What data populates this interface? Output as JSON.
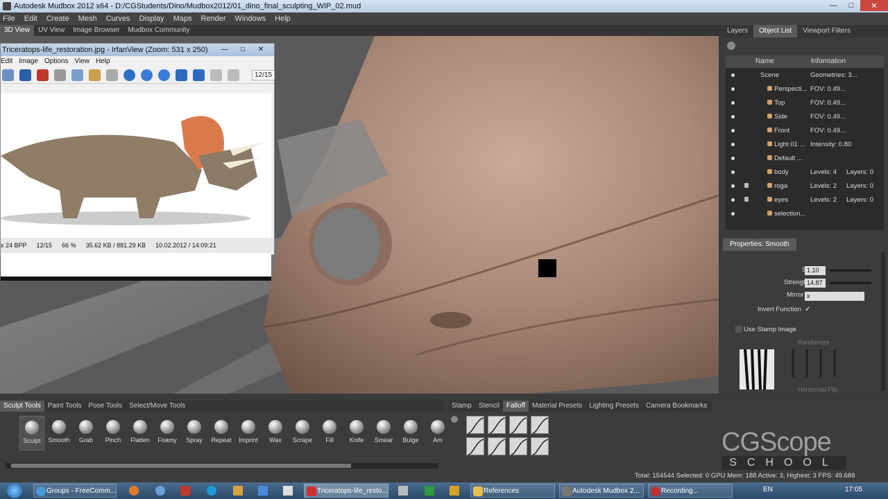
{
  "window": {
    "title": "Autodesk Mudbox 2012 x64 - D:/CGStudents/Dino/Mudbox2012/01_dino_final_sculpting_WIP_02.mud"
  },
  "menu": [
    "File",
    "Edit",
    "Create",
    "Mesh",
    "Curves",
    "Display",
    "Maps",
    "Render",
    "Windows",
    "Help"
  ],
  "view_tabs": [
    "3D View",
    "UV View",
    "Image Browser",
    "Mudbox Community"
  ],
  "irfanview": {
    "title": "Triceratops-life_restoration.jpg - IrfanView (Zoom: 531 x 250)",
    "menu": [
      "Edit",
      "Image",
      "Options",
      "View",
      "Help"
    ],
    "counter": "12/15",
    "status": [
      "x 24 BPP",
      "12/15",
      "66 %",
      "35.62 KB / 881.29 KB",
      "10.02.2012 / 14:09:21"
    ]
  },
  "right_tabs": [
    "Layers",
    "Object List",
    "Viewport Filters"
  ],
  "object_list": {
    "headers": [
      "Name",
      "Information"
    ],
    "rows": [
      {
        "name": "Scene",
        "info": "Geometries: 3...",
        "layers": "",
        "icon": "none",
        "lock": false
      },
      {
        "name": "Perspecti...",
        "info": "FOV: 0.49...",
        "layers": "",
        "icon": "camera-icon",
        "lock": false
      },
      {
        "name": "Top",
        "info": "FOV: 0.49...",
        "layers": "",
        "icon": "camera-icon",
        "lock": false
      },
      {
        "name": "Side",
        "info": "FOV: 0.49...",
        "layers": "",
        "icon": "camera-icon",
        "lock": false
      },
      {
        "name": "Front",
        "info": "FOV: 0.49...",
        "layers": "",
        "icon": "camera-icon",
        "lock": false
      },
      {
        "name": "Light 01 ...",
        "info": "Intensity: 0.80",
        "layers": "",
        "icon": "light-icon",
        "lock": false
      },
      {
        "name": "Default ...",
        "info": "",
        "layers": "",
        "icon": "material-icon",
        "lock": false
      },
      {
        "name": "body",
        "info": "Levels: 4",
        "layers": "Layers: 0",
        "icon": "mesh-icon",
        "lock": false
      },
      {
        "name": "roga",
        "info": "Levels: 2",
        "layers": "Layers: 0",
        "icon": "mesh-icon",
        "lock": true
      },
      {
        "name": "eyes",
        "info": "Levels: 2",
        "layers": "Layers: 0",
        "icon": "mesh-icon",
        "lock": true
      },
      {
        "name": "selection...",
        "info": "",
        "layers": "",
        "icon": "selection-icon",
        "lock": false
      }
    ]
  },
  "properties": {
    "tab": "Properties: Smooth",
    "size_label": "Size",
    "size_value": "1.10",
    "strength_label": "Strength",
    "strength_value": "14.87",
    "mirror_label": "Mirror",
    "mirror_value": "x",
    "invert_label": "Invert Function",
    "stamp_label": "Use Stamp Image",
    "randomize_label": "Randomize",
    "horizontal_flip_label": "Horizontal Flip"
  },
  "tool_tabs": [
    "Sculpt Tools",
    "Paint Tools",
    "Pose Tools",
    "Select/Move Tools"
  ],
  "tools": [
    "Sculpt",
    "Smooth",
    "Grab",
    "Pinch",
    "Flatten",
    "Foamy",
    "Spray",
    "Repeat",
    "Imprint",
    "Wax",
    "Scrape",
    "Fill",
    "Knife",
    "Smear",
    "Bulge",
    "Am"
  ],
  "tray_tabs": [
    "Stamp",
    "Stencil",
    "Falloff",
    "Material Presets",
    "Lighting Presets",
    "Camera Bookmarks"
  ],
  "status": "Total: 154544  Selected: 0 GPU Mem: 188  Active: 3, Highest: 3  FPS: 49.688",
  "logo": {
    "top": "CGScope",
    "bottom": "SCHOOL"
  },
  "taskbar": {
    "items": [
      "Groups - FreeComm...",
      "Triceratops-life_resto...",
      "References",
      "Autodesk Mudbox 2...",
      "Recording..."
    ],
    "lang": "EN",
    "time": "17:05"
  }
}
